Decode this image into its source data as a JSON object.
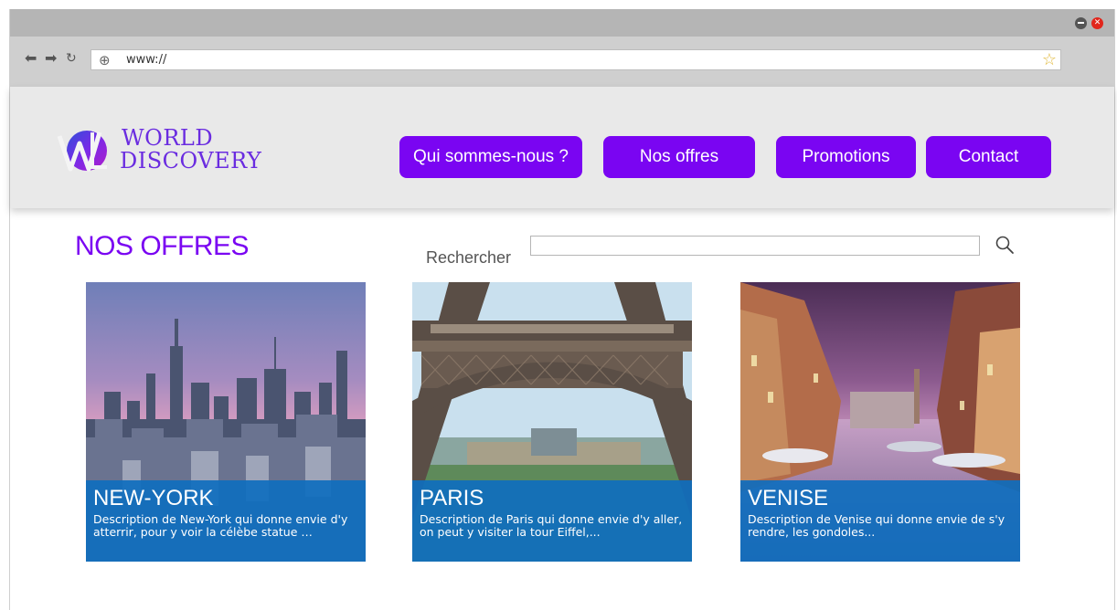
{
  "browser": {
    "url": "www://",
    "back_icon": "arrow-left-icon",
    "forward_icon": "arrow-right-icon",
    "reload_icon": "reload-icon",
    "globe_icon": "globe-icon",
    "bookmark_icon": "star-icon",
    "close_symbol": "✕"
  },
  "site": {
    "logo": {
      "line1": "WORLD",
      "line2": "DISCOVERY"
    },
    "nav": [
      {
        "label": "Qui sommes-nous ?"
      },
      {
        "label": "Nos offres"
      },
      {
        "label": "Promotions"
      },
      {
        "label": "Contact"
      }
    ]
  },
  "main": {
    "title": "NOS OFFRES",
    "search": {
      "label": "Rechercher",
      "value": "",
      "placeholder": ""
    },
    "offers": [
      {
        "title": "NEW-YORK",
        "description": "Description de New-York qui donne envie d'y atterrir, pour y voir la célèbe statue …"
      },
      {
        "title": "PARIS",
        "description": "Description de Paris qui donne envie d'y aller, on peut y visiter la tour Eiffel,..."
      },
      {
        "title": "VENISE",
        "description": "Description de Venise qui donne envie de s'y rendre, les gondoles..."
      }
    ]
  },
  "colors": {
    "accent": "#7a05f2",
    "caption_bg": "#0f6ebe",
    "header_bg": "#e9e9e9"
  }
}
